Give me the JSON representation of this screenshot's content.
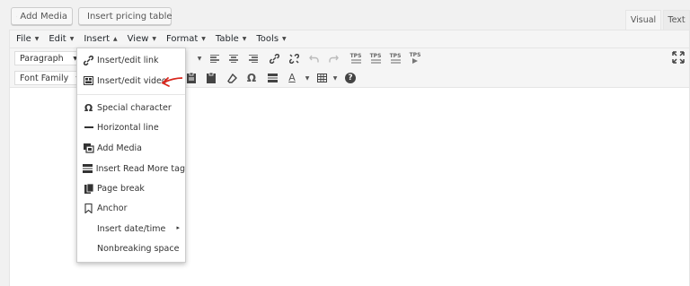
{
  "top_buttons": {
    "add_media": "Add Media",
    "insert_pricing_table": "Insert pricing table"
  },
  "editor_tabs": {
    "visual": "Visual",
    "text": "Text"
  },
  "menubar": {
    "items": [
      {
        "label": "File",
        "caret": "▼"
      },
      {
        "label": "Edit",
        "caret": "▼"
      },
      {
        "label": "Insert",
        "caret": "▲"
      },
      {
        "label": "View",
        "caret": "▼"
      },
      {
        "label": "Format",
        "caret": "▼"
      },
      {
        "label": "Table",
        "caret": "▼"
      },
      {
        "label": "Tools",
        "caret": "▼"
      }
    ]
  },
  "toolbar": {
    "paragraph_select": "Paragraph",
    "font_family_select": "Font Family",
    "row1_icons": [
      "align-left-icon",
      "align-center-icon",
      "align-right-icon",
      "link-icon",
      "unlink-icon",
      "undo-icon",
      "redo-icon",
      "tps-list-icon-1",
      "tps-list-icon-2",
      "tps-list-icon-3",
      "tps-play-icon",
      "fullscreen-icon"
    ],
    "row2_icons": [
      "paste-text-icon",
      "clear-formatting-icon",
      "omega-icon",
      "read-more-icon",
      "text-color-icon",
      "table-icon",
      "help-icon"
    ],
    "tps_label": "TPS",
    "omega": "Ω",
    "text_color_glyph": "A",
    "help_glyph": "?"
  },
  "insert_menu": {
    "items": [
      {
        "label": "Insert/edit link",
        "icon": "link-icon"
      },
      {
        "label": "Insert/edit video",
        "icon": "video-icon"
      },
      {
        "label": "Special character",
        "icon": "omega-icon",
        "glyph": "Ω"
      },
      {
        "label": "Horizontal line",
        "icon": "horizontal-line-icon"
      },
      {
        "label": "Add Media",
        "icon": "media-icon"
      },
      {
        "label": "Insert Read More tag",
        "icon": "read-more-icon"
      },
      {
        "label": "Page break",
        "icon": "page-break-icon"
      },
      {
        "label": "Anchor",
        "icon": "bookmark-icon"
      },
      {
        "label": "Insert date/time",
        "icon": "",
        "submenu": "▸"
      },
      {
        "label": "Nonbreaking space",
        "icon": ""
      }
    ]
  },
  "colors": {
    "annotation_arrow": "#d9261c",
    "text_color_bar": "#000000"
  }
}
